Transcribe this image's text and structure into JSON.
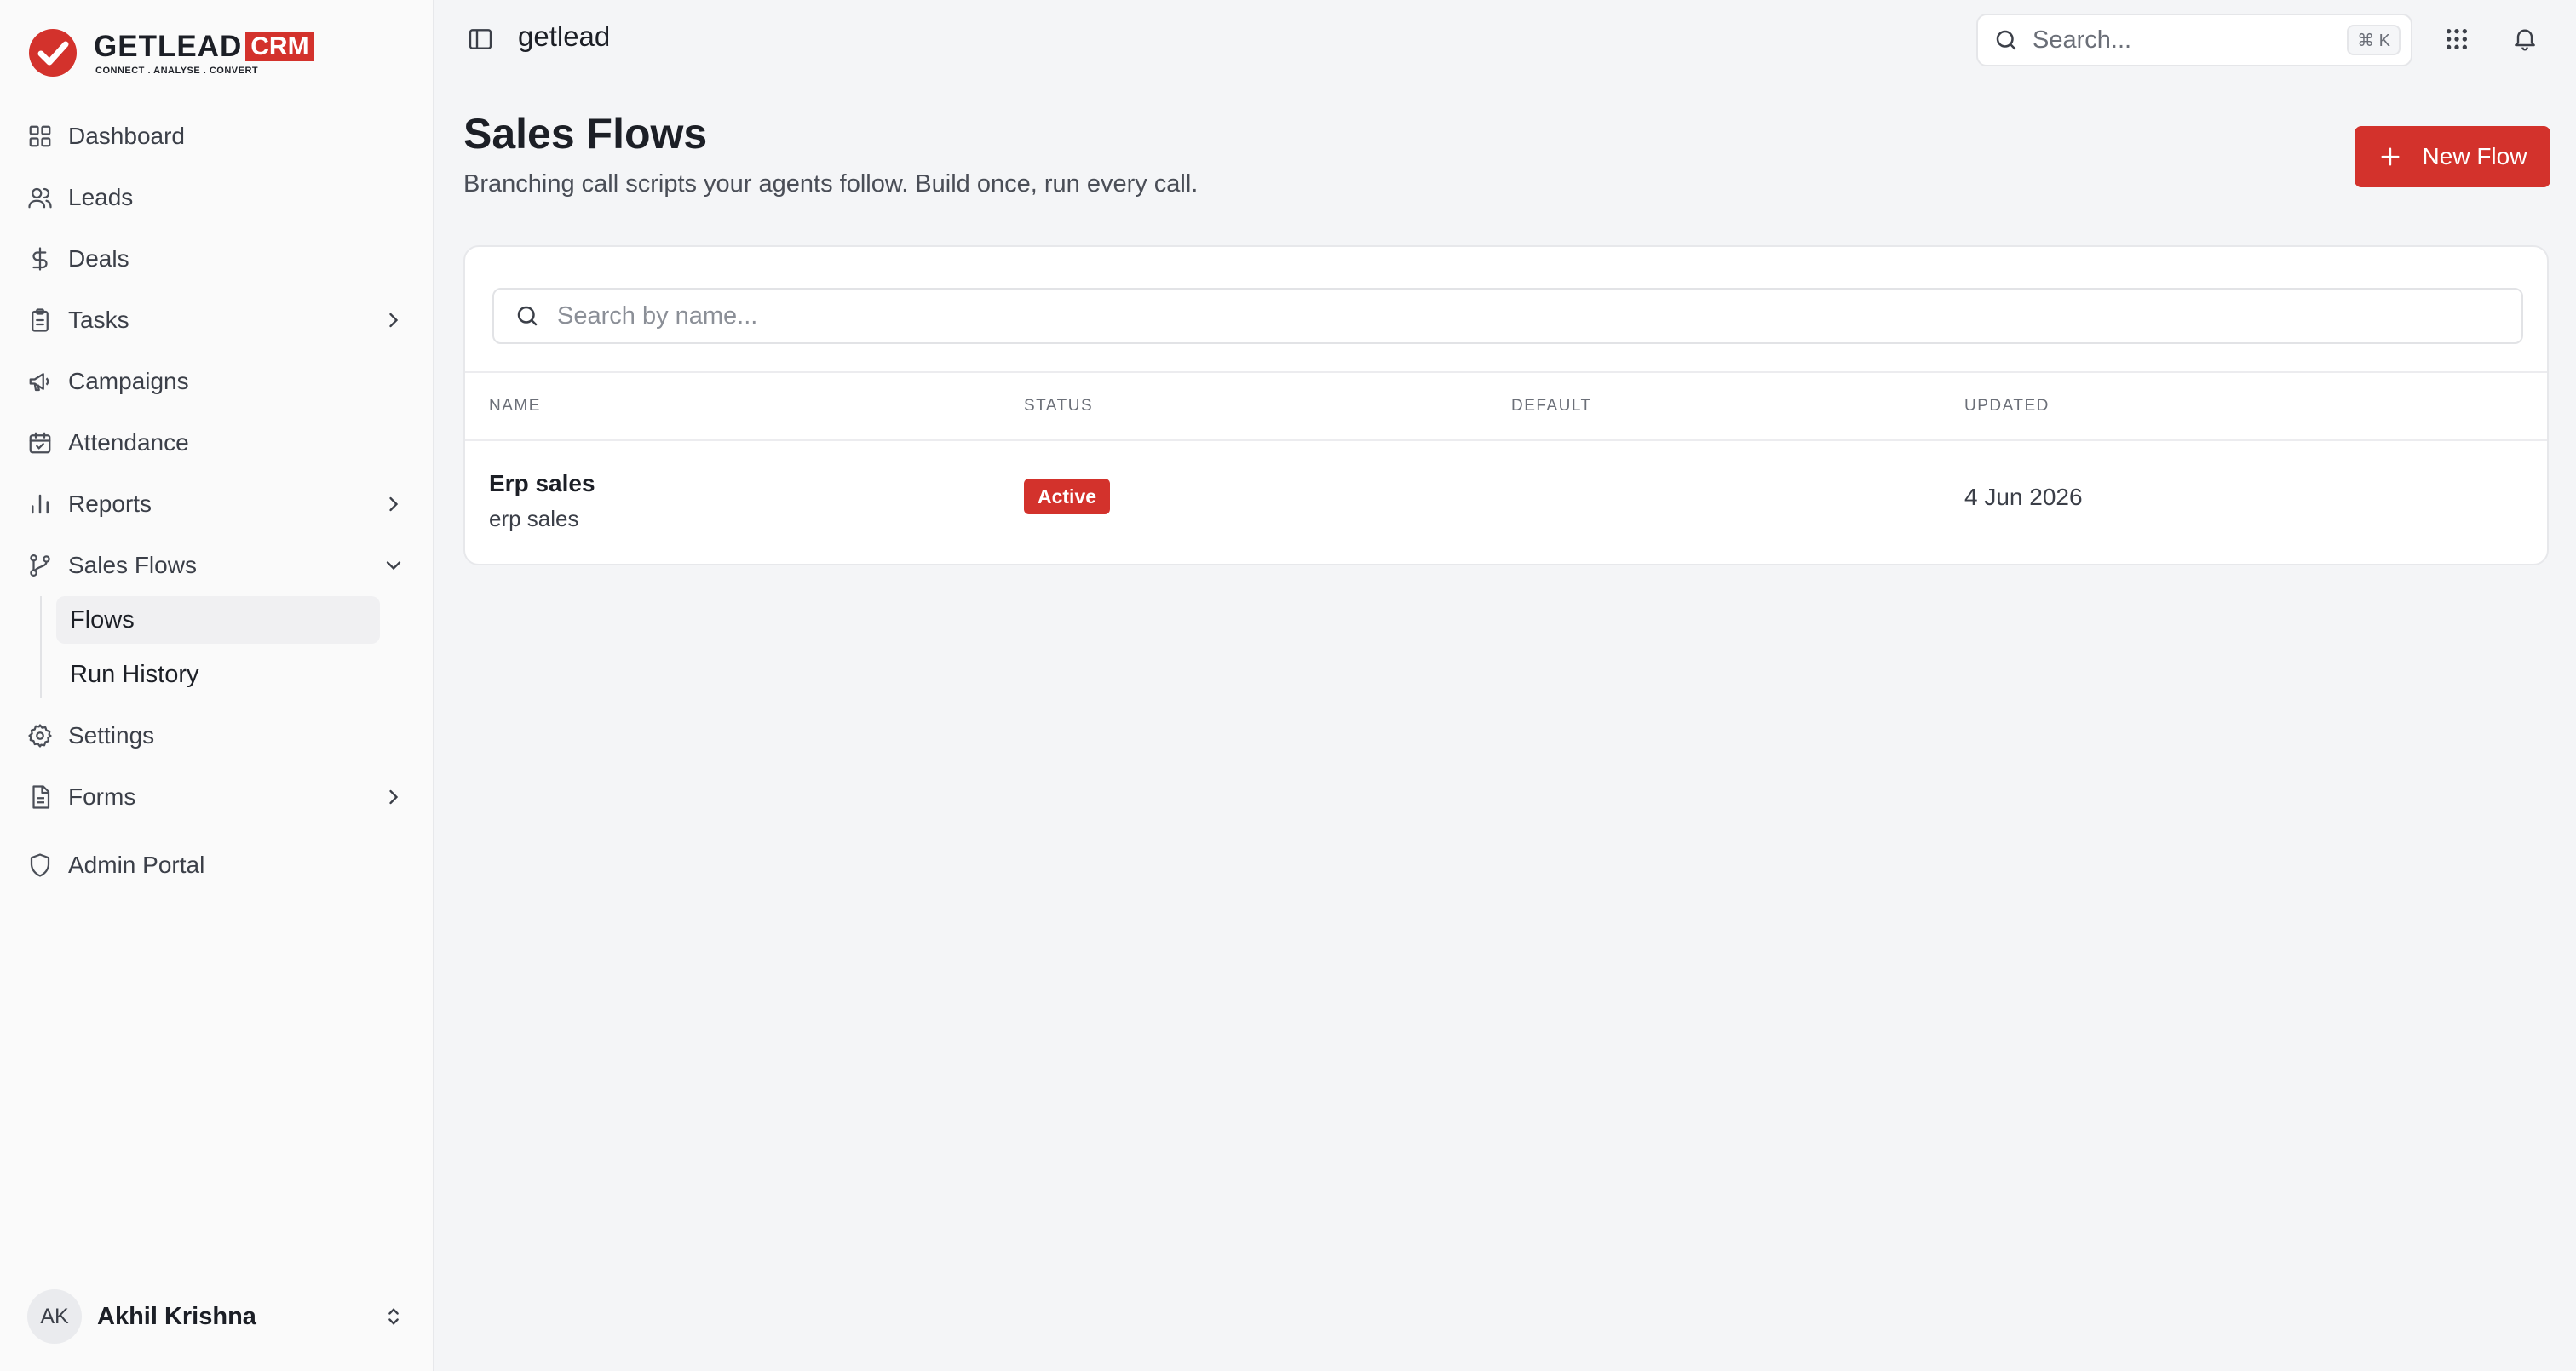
{
  "brand": {
    "word": "GETLEAD",
    "suffix": "CRM",
    "tagline": "CONNECT  .  ANALYSE  .  CONVERT",
    "accent_color": "#d3322c"
  },
  "sidebar": {
    "items": [
      {
        "label": "Dashboard",
        "icon": "dashboard-grid-icon"
      },
      {
        "label": "Leads",
        "icon": "users-icon"
      },
      {
        "label": "Deals",
        "icon": "dollar-icon"
      },
      {
        "label": "Tasks",
        "icon": "clipboard-icon",
        "expandable": true
      },
      {
        "label": "Campaigns",
        "icon": "megaphone-icon"
      },
      {
        "label": "Attendance",
        "icon": "calendar-check-icon"
      },
      {
        "label": "Reports",
        "icon": "bar-chart-icon",
        "expandable": true
      },
      {
        "label": "Sales Flows",
        "icon": "git-branch-icon",
        "expanded": true
      },
      {
        "label": "Settings",
        "icon": "gear-icon"
      },
      {
        "label": "Forms",
        "icon": "document-icon",
        "expandable": true
      },
      {
        "label": "Admin Portal",
        "icon": "shield-icon"
      }
    ],
    "sales_flows_sub": [
      {
        "label": "Flows",
        "active": true
      },
      {
        "label": "Run History",
        "active": false
      }
    ],
    "user": {
      "initials": "AK",
      "name": "Akhil Krishna"
    }
  },
  "header": {
    "workspace": "getlead",
    "search_placeholder": "Search...",
    "search_shortcut": "⌘ K"
  },
  "page": {
    "title": "Sales Flows",
    "subtitle": "Branching call scripts your agents follow. Build once, run every call.",
    "new_button_label": "New Flow",
    "search_placeholder": "Search by name..."
  },
  "table": {
    "columns": [
      "NAME",
      "STATUS",
      "DEFAULT",
      "UPDATED"
    ],
    "rows": [
      {
        "name": "Erp sales",
        "description": "erp sales",
        "status": "Active",
        "default": "",
        "updated": "4 Jun 2026"
      }
    ]
  }
}
